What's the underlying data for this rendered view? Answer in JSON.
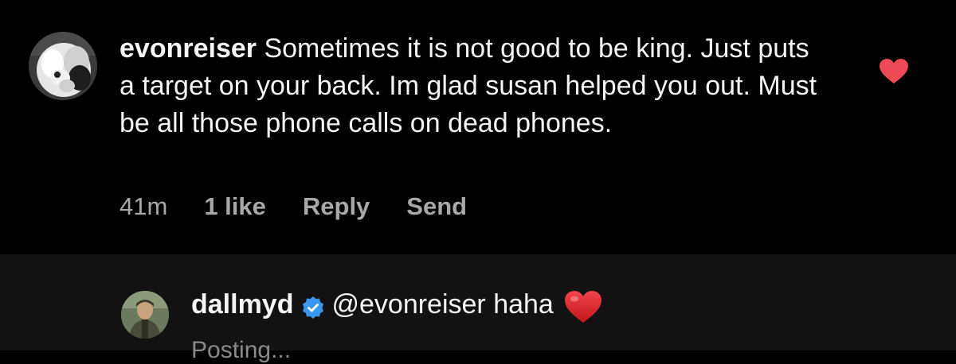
{
  "comment": {
    "username": "evonreiser",
    "text": "Sometimes it is not good to be king. Just puts a target on your back. Im glad susan helped you out. Must be all those phone calls on dead phones.",
    "time": "41m",
    "likes": "1 like",
    "reply_label": "Reply",
    "send_label": "Send",
    "liked": true,
    "like_icon": "heart-filled-icon",
    "like_color": "#ed4956"
  },
  "reply": {
    "username": "dallmyd",
    "verified": true,
    "verified_icon": "verified-badge-icon",
    "verified_color": "#3897f0",
    "text": "@evonreiser haha",
    "emoji": "red-heart-emoji",
    "status": "Posting..."
  },
  "colors": {
    "background": "#000000",
    "reply_background": "#121212",
    "meta_text": "#a8a8a8"
  }
}
